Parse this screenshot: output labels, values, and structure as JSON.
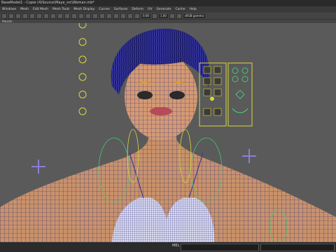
{
  "window": {
    "title": "BaseModel1 - Copie (4)Source\\Maya_src\\Woman.mb*"
  },
  "menu": [
    "Windows",
    "Mesh",
    "Edit Mesh",
    "Mesh Tools",
    "Mesh Display",
    "Curves",
    "Surfaces",
    "Deform",
    "UV",
    "Generate",
    "Cache",
    "Help"
  ],
  "toolbar": {
    "value_a": "0.00",
    "value_b": "1.00",
    "camera": "sRGB gamma"
  },
  "panel": {
    "label": "Panels"
  },
  "status": {
    "mel_label": "MEL"
  },
  "colors": {
    "viewport_bg": "#5a5a5a",
    "wire": "#2d2d80",
    "skin": "#c9926a",
    "control_yellow": "#d8d83a",
    "control_green": "#4cc37a",
    "control_purple": "#8a7ed8"
  },
  "icons": [
    "grid-icon",
    "camera-icon",
    "lighting-icon",
    "isolate-icon"
  ]
}
